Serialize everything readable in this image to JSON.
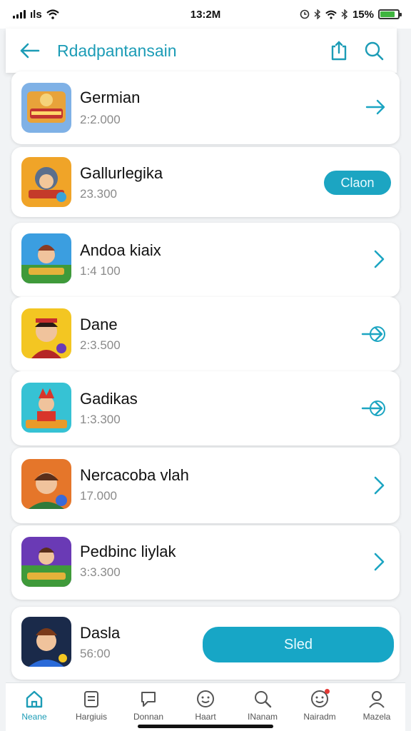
{
  "status_bar": {
    "carrier": "ıls",
    "time": "13:2M",
    "battery_text": "15%",
    "battery_level": 0.85,
    "battery_color": "#3fb53f"
  },
  "header": {
    "title": "Rdadpantansain",
    "back_icon": "back-arrow-icon",
    "share_icon": "share-icon",
    "search_icon": "search-icon",
    "accent": "#1c9cb6"
  },
  "items": [
    {
      "name": "Germian",
      "count": "2:2.000",
      "action": "arrow-right-icon"
    },
    {
      "name": "Gallurlegika",
      "count": "23.300",
      "action_button": "Claon"
    },
    {
      "name": "Andoa kiaix",
      "count": "1:4 100",
      "action": "chevron-right-icon"
    },
    {
      "name": "Dane",
      "count": "2:3.500",
      "action": "arrow-in-icon"
    },
    {
      "name": "Gadikas",
      "count": "1:3.300",
      "action": "arrow-in-icon"
    },
    {
      "name": "Nercacoba vlah",
      "count": "17.000",
      "action": "chevron-right-icon"
    },
    {
      "name": "Pedbinc liylak",
      "count": "3:3.300",
      "action": "chevron-right-icon"
    },
    {
      "name": "Dasla",
      "count": "56:00",
      "action_button": "Sled"
    }
  ],
  "bottom_nav": [
    {
      "label": "Neane",
      "icon": "home-icon",
      "active": true
    },
    {
      "label": "Hargiuis",
      "icon": "clipboard-icon",
      "active": false
    },
    {
      "label": "Donnan",
      "icon": "chat-icon",
      "active": false
    },
    {
      "label": "Haart",
      "icon": "smiley-icon",
      "active": false
    },
    {
      "label": "INanam",
      "icon": "search-icon",
      "active": false
    },
    {
      "label": "Nairadm",
      "icon": "notification-smiley-icon",
      "active": false
    },
    {
      "label": "Mazela",
      "icon": "profile-icon",
      "active": false
    }
  ]
}
